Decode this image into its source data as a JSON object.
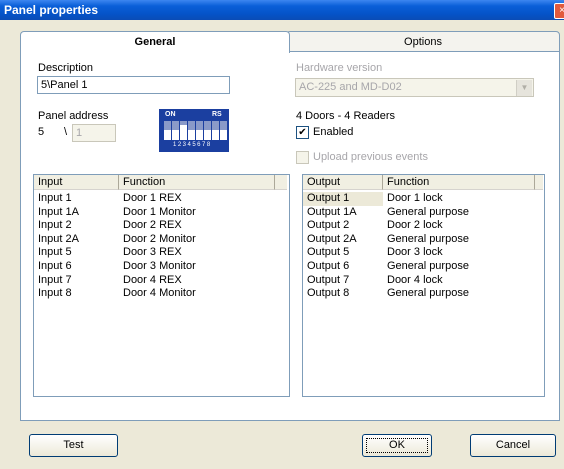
{
  "window": {
    "title": "Panel properties",
    "close_symbol": "×"
  },
  "tabs": {
    "general": "General",
    "options": "Options"
  },
  "description": {
    "label": "Description",
    "value": "5\\Panel 1"
  },
  "panel_address": {
    "label": "Panel address",
    "prefix": "5",
    "separator": "\\",
    "value": "1"
  },
  "dip_switch": {
    "on_label": "ON",
    "rs_label": "RS",
    "numbers": "12345678"
  },
  "hardware": {
    "label": "Hardware version",
    "value": "AC-225 and MD-D02",
    "doors_readers": "4 Doors - 4 Readers",
    "enabled_label": "Enabled",
    "enabled_check": "✔",
    "upload_label": "Upload previous events"
  },
  "inputs": {
    "col_input": "Input",
    "col_function": "Function",
    "rows": [
      {
        "name": "Input 1",
        "function": "Door 1 REX"
      },
      {
        "name": "Input 1A",
        "function": "Door 1 Monitor"
      },
      {
        "name": "Input 2",
        "function": "Door 2 REX"
      },
      {
        "name": "Input 2A",
        "function": "Door 2 Monitor"
      },
      {
        "name": "Input 5",
        "function": "Door 3 REX"
      },
      {
        "name": "Input 6",
        "function": "Door 3 Monitor"
      },
      {
        "name": "Input 7",
        "function": "Door 4 REX"
      },
      {
        "name": "Input 8",
        "function": "Door 4 Monitor"
      }
    ]
  },
  "outputs": {
    "col_output": "Output",
    "col_function": "Function",
    "rows": [
      {
        "name": "Output 1",
        "function": "Door 1 lock"
      },
      {
        "name": "Output 1A",
        "function": "General purpose"
      },
      {
        "name": "Output 2",
        "function": "Door 2 lock"
      },
      {
        "name": "Output 2A",
        "function": "General purpose"
      },
      {
        "name": "Output 5",
        "function": "Door 3 lock"
      },
      {
        "name": "Output 6",
        "function": "General purpose"
      },
      {
        "name": "Output 7",
        "function": "Door 4 lock"
      },
      {
        "name": "Output 8",
        "function": "General purpose"
      }
    ]
  },
  "buttons": {
    "test": "Test",
    "ok": "OK",
    "cancel": "Cancel"
  }
}
